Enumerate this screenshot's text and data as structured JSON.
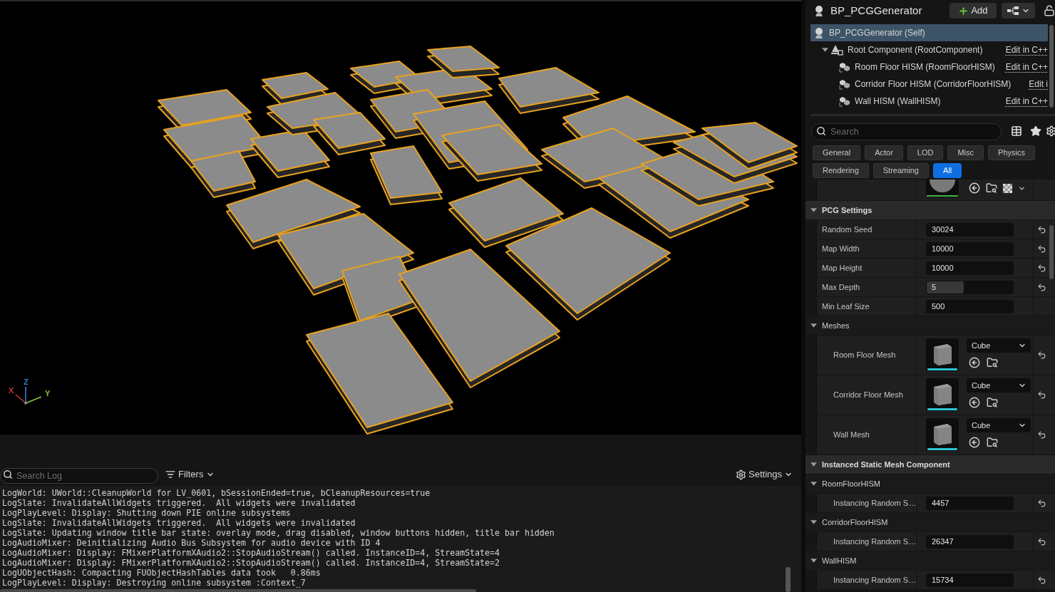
{
  "viewport": {
    "axes": [
      {
        "label": "X",
        "color": "#c8382b"
      },
      {
        "label": "Z",
        "color": "#3a7bd5"
      },
      {
        "label": "Y",
        "color": "#8cc43c"
      }
    ]
  },
  "output_log": {
    "search": {
      "placeholder": "Search Log"
    },
    "filters_button": "Filters",
    "settings_button": "Settings",
    "lines": [
      "LogWorld: UWorld::CleanupWorld for LV_0601, bSessionEnded=true, bCleanupResources=true",
      "LogSlate: InvalidateAllWidgets triggered.  All widgets were invalidated",
      "LogPlayLevel: Display: Shutting down PIE online subsystems",
      "LogSlate: InvalidateAllWidgets triggered.  All widgets were invalidated",
      "LogSlate: Updating window title bar state: overlay mode, drag disabled, window buttons hidden, title bar hidden",
      "LogAudioMixer: Deinitializing Audio Bus Subsystem for audio device with ID 4",
      "LogAudioMixer: Display: FMixerPlatformXAudio2::StopAudioStream() called. InstanceID=4, StreamState=4",
      "LogAudioMixer: Display: FMixerPlatformXAudio2::StopAudioStream() called. InstanceID=4, StreamState=2",
      "LogUObjectHash: Compacting FUObjectHashTables data took   0.86ms",
      "LogPlayLevel: Display: Destroying online subsystem :Context_7"
    ]
  },
  "components_panel": {
    "title": "BP_PCGGenerator",
    "add_button": "Add",
    "tree": [
      {
        "kind": "actor",
        "label": "BP_PCGGenerator (Self)",
        "selected": true,
        "children": [
          {
            "kind": "scene",
            "label": "Root Component (RootComponent)",
            "link": "Edit in C++",
            "selected": false,
            "expanded": true,
            "children": [
              {
                "kind": "hism",
                "label": "Room Floor HISM (RoomFloorHISM)",
                "link": "Edit in C++",
                "selected": false
              },
              {
                "kind": "hism",
                "label": "Corridor Floor HISM (CorridorFloorHISM)",
                "link": "Edit i",
                "selected": false
              },
              {
                "kind": "hism",
                "label": "Wall HISM (WallHISM)",
                "link": "Edit in C++",
                "selected": false
              }
            ]
          }
        ]
      }
    ]
  },
  "details_panel": {
    "search": {
      "placeholder": "Search"
    },
    "filter_tabs": [
      {
        "label": "General",
        "selected": false
      },
      {
        "label": "Actor",
        "selected": false
      },
      {
        "label": "LOD",
        "selected": false
      },
      {
        "label": "Misc",
        "selected": false
      },
      {
        "label": "Physics",
        "selected": false
      },
      {
        "label": "Rendering",
        "selected": false
      },
      {
        "label": "Streaming",
        "selected": false
      },
      {
        "label": "All",
        "selected": true
      }
    ],
    "sections": [
      {
        "title": "PCG Settings",
        "expanded": true,
        "properties": [
          {
            "kind": "number",
            "label": "Random Seed",
            "value": "30024",
            "modified": true
          },
          {
            "kind": "number",
            "label": "Map Width",
            "value": "10000",
            "modified": true
          },
          {
            "kind": "number",
            "label": "Map Height",
            "value": "10000",
            "modified": true
          },
          {
            "kind": "slider",
            "label": "Max Depth",
            "value": "5",
            "level": 0.42,
            "modified": true
          },
          {
            "kind": "number",
            "label": "Min Leaf Size",
            "value": "500",
            "modified": false
          }
        ],
        "children": [
          {
            "title": "Meshes",
            "expanded": true,
            "properties": [
              {
                "kind": "mesh",
                "label": "Room Floor Mesh",
                "value": "Cube",
                "modified": true
              },
              {
                "kind": "mesh",
                "label": "Corridor Floor Mesh",
                "value": "Cube",
                "modified": true
              },
              {
                "kind": "mesh",
                "label": "Wall Mesh",
                "value": "Cube",
                "modified": true
              }
            ]
          }
        ]
      },
      {
        "title": "Instanced Static Mesh Component",
        "expanded": true,
        "children": [
          {
            "title": "RoomFloorHISM",
            "expanded": true,
            "properties": [
              {
                "kind": "number",
                "label": "Instancing Random S…",
                "value": "4457",
                "modified": true
              }
            ]
          },
          {
            "title": "CorridorFloorHISM",
            "expanded": true,
            "properties": [
              {
                "kind": "number",
                "label": "Instancing Random S…",
                "value": "26347",
                "modified": true
              }
            ]
          },
          {
            "title": "WallHISM",
            "expanded": true,
            "properties": [
              {
                "kind": "number",
                "label": "Instancing Random S…",
                "value": "15734",
                "modified": true
              }
            ]
          }
        ]
      }
    ]
  }
}
